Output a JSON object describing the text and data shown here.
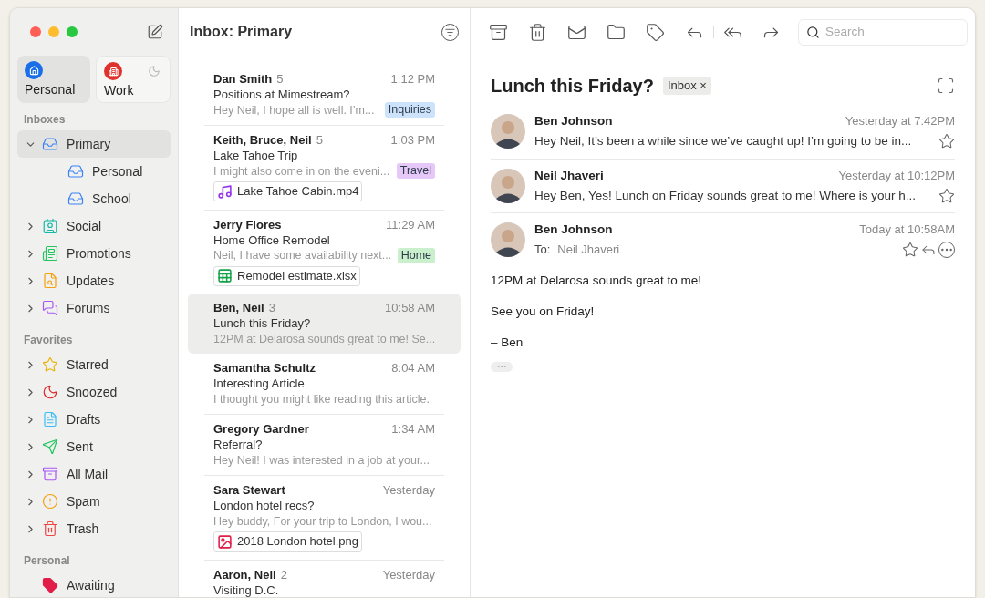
{
  "sidebar": {
    "accounts": [
      {
        "name": "Personal",
        "kind": "home",
        "color": "#1a6fe8",
        "selected": true,
        "dnd": false
      },
      {
        "name": "Work",
        "kind": "work",
        "color": "#e0322c",
        "selected": false,
        "dnd": true
      }
    ],
    "sections": [
      {
        "title": "Inboxes",
        "items": [
          {
            "label": "Primary",
            "kind": "inbox",
            "expanded": true,
            "selected": true,
            "children": [
              {
                "label": "Personal",
                "kind": "inbox",
                "selected": false
              },
              {
                "label": "School",
                "kind": "inbox",
                "selected": false
              }
            ]
          },
          {
            "label": "Social",
            "kind": "social",
            "expanded": false,
            "selected": false
          },
          {
            "label": "Promotions",
            "kind": "promotions",
            "expanded": false,
            "selected": false
          },
          {
            "label": "Updates",
            "kind": "updates",
            "expanded": false,
            "selected": false
          },
          {
            "label": "Forums",
            "kind": "forums",
            "expanded": false,
            "selected": false
          }
        ]
      },
      {
        "title": "Favorites",
        "items": [
          {
            "label": "Starred",
            "kind": "star",
            "expanded": false,
            "selected": false
          },
          {
            "label": "Snoozed",
            "kind": "snooze",
            "expanded": false,
            "selected": false
          },
          {
            "label": "Drafts",
            "kind": "drafts",
            "expanded": false,
            "selected": false
          },
          {
            "label": "Sent",
            "kind": "sent",
            "expanded": false,
            "selected": false
          },
          {
            "label": "All Mail",
            "kind": "allmail",
            "expanded": false,
            "selected": false
          },
          {
            "label": "Spam",
            "kind": "spam",
            "expanded": false,
            "selected": false
          },
          {
            "label": "Trash",
            "kind": "trash",
            "expanded": false,
            "selected": false
          }
        ]
      },
      {
        "title": "Personal",
        "items": [
          {
            "label": "Awaiting",
            "kind": "label"
          }
        ]
      }
    ]
  },
  "list": {
    "title": "Inbox: Primary",
    "messages": [
      {
        "sender": "Dan Smith",
        "count": "5",
        "time": "1:12 PM",
        "subject": "Positions at Mimestream?",
        "preview": "Hey Neil, I hope all is well. I’m...",
        "tag": {
          "label": "Inquiries",
          "color": "#cde3fb"
        },
        "selected": false
      },
      {
        "sender": "Keith, Bruce, Neil",
        "count": "5",
        "time": "1:03 PM",
        "subject": "Lake Tahoe Trip",
        "preview": "I might also come in on the eveni...",
        "tag": {
          "label": "Travel",
          "color": "#e5c8f7"
        },
        "attachment": {
          "name": "Lake Tahoe Cabin.mp4",
          "kind": "video"
        },
        "selected": false
      },
      {
        "sender": "Jerry Flores",
        "time": "11:29 AM",
        "subject": "Home Office Remodel",
        "preview": "Neil, I have some availability next...",
        "tag": {
          "label": "Home",
          "color": "#c9efcd"
        },
        "attachment": {
          "name": "Remodel estimate.xlsx",
          "kind": "sheet"
        },
        "selected": false
      },
      {
        "sender": "Ben, Neil",
        "count": "3",
        "time": "10:58 AM",
        "subject": "Lunch this Friday?",
        "preview": "12PM at Delarosa sounds great to me! Se...",
        "selected": true
      },
      {
        "sender": "Samantha Schultz",
        "time": "8:04 AM",
        "subject": "Interesting Article",
        "preview": "I thought you might like reading this article.",
        "selected": false
      },
      {
        "sender": "Gregory Gardner",
        "time": "1:34 AM",
        "subject": "Referral?",
        "preview": "Hey Neil! I was interested in a job at your...",
        "selected": false
      },
      {
        "sender": "Sara Stewart",
        "time": "Yesterday",
        "subject": "London hotel recs?",
        "preview": "Hey buddy, For your trip to London, I wou...",
        "attachment": {
          "name": "2018 London hotel.png",
          "kind": "image"
        },
        "selected": false
      },
      {
        "sender": "Aaron, Neil",
        "count": "2",
        "time": "Yesterday",
        "subject": "Visiting D.C.",
        "selected": false
      }
    ]
  },
  "search": {
    "placeholder": "Search"
  },
  "thread": {
    "subject": "Lunch this Friday?",
    "label": "Inbox",
    "label_remove": "×",
    "messages": [
      {
        "sender": "Ben Johnson",
        "time": "Yesterday at 7:42PM",
        "preview": "Hey Neil, It’s been a while since we’ve caught up! I’m going to be in...",
        "starred": false,
        "expanded": false
      },
      {
        "sender": "Neil Jhaveri",
        "time": "Yesterday at 10:12PM",
        "preview": "Hey Ben, Yes! Lunch on Friday sounds great to me! Where is your h...",
        "starred": false,
        "expanded": false
      },
      {
        "sender": "Ben Johnson",
        "time": "Today at 10:58AM",
        "to_label": "To:",
        "to": "Neil Jhaveri",
        "starred": false,
        "expanded": true,
        "body": [
          "12PM at Delarosa sounds great to me!",
          "See you on Friday!",
          "– Ben"
        ]
      }
    ]
  }
}
